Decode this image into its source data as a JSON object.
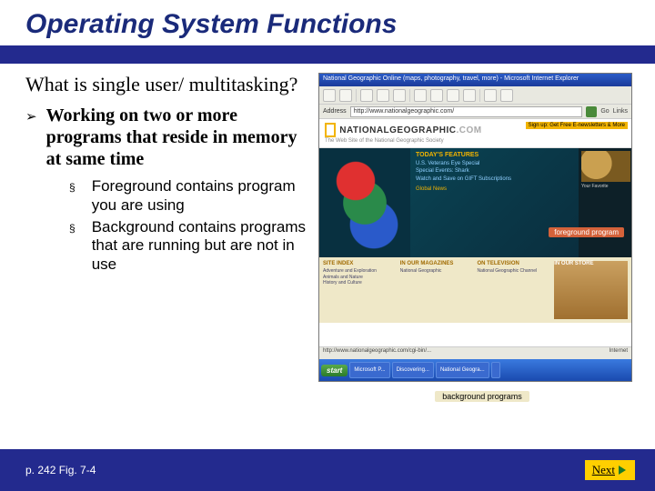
{
  "title": "Operating System Functions",
  "question": "What is single user/ multitasking?",
  "main_bullet": {
    "marker": "➢",
    "text": "Working on two or more programs that reside in memory at same time"
  },
  "sub_bullets": [
    {
      "marker": "§",
      "text": "Foreground contains program you are using"
    },
    {
      "marker": "§",
      "text": "Background contains programs that are running but are not in use"
    }
  ],
  "browser": {
    "window_title": "National Geographic Online (maps, photography, travel, more) - Microsoft Internet Explorer",
    "addr_label": "Address",
    "addr_value": "http://www.nationalgeographic.com/",
    "go_label": "Go",
    "links_label": "Links",
    "brand_main": "NATIONALGEOGRAPHIC",
    "brand_suffix": ".COM",
    "tagline": "The Web Site of the National Geographic Society",
    "signup": "Sign up: Get Free E-newsletters & More",
    "features_title": "TODAY'S FEATURES",
    "feature_links": [
      "U.S. Veterans Eye Special",
      "Special Events: Shark",
      "Watch and Save on GIFT Subscriptions"
    ],
    "globalnews": "Global News",
    "foreground_label": "foreground program",
    "right_title": "Your Favorite",
    "sections": [
      {
        "title": "SITE INDEX",
        "items": [
          "Adventure and Exploration",
          "Animals and Nature",
          "History and Culture"
        ]
      },
      {
        "title": "IN OUR MAGAZINES",
        "items": [
          "National Geographic"
        ]
      },
      {
        "title": "ON TELEVISION",
        "items": [
          "National Geographic Channel"
        ]
      },
      {
        "title": "IN OUR STORE",
        "items": [
          ""
        ]
      }
    ],
    "status_url": "http://www.nationalgeographic.com/cgi-bin/...",
    "status_zone": "Internet"
  },
  "taskbar": {
    "start": "start",
    "items": [
      "Microsoft P...",
      "Discovering...",
      "National Geogra...",
      ""
    ]
  },
  "background_label": "background programs",
  "page_ref": "p. 242 Fig. 7-4",
  "next_label": "Next"
}
